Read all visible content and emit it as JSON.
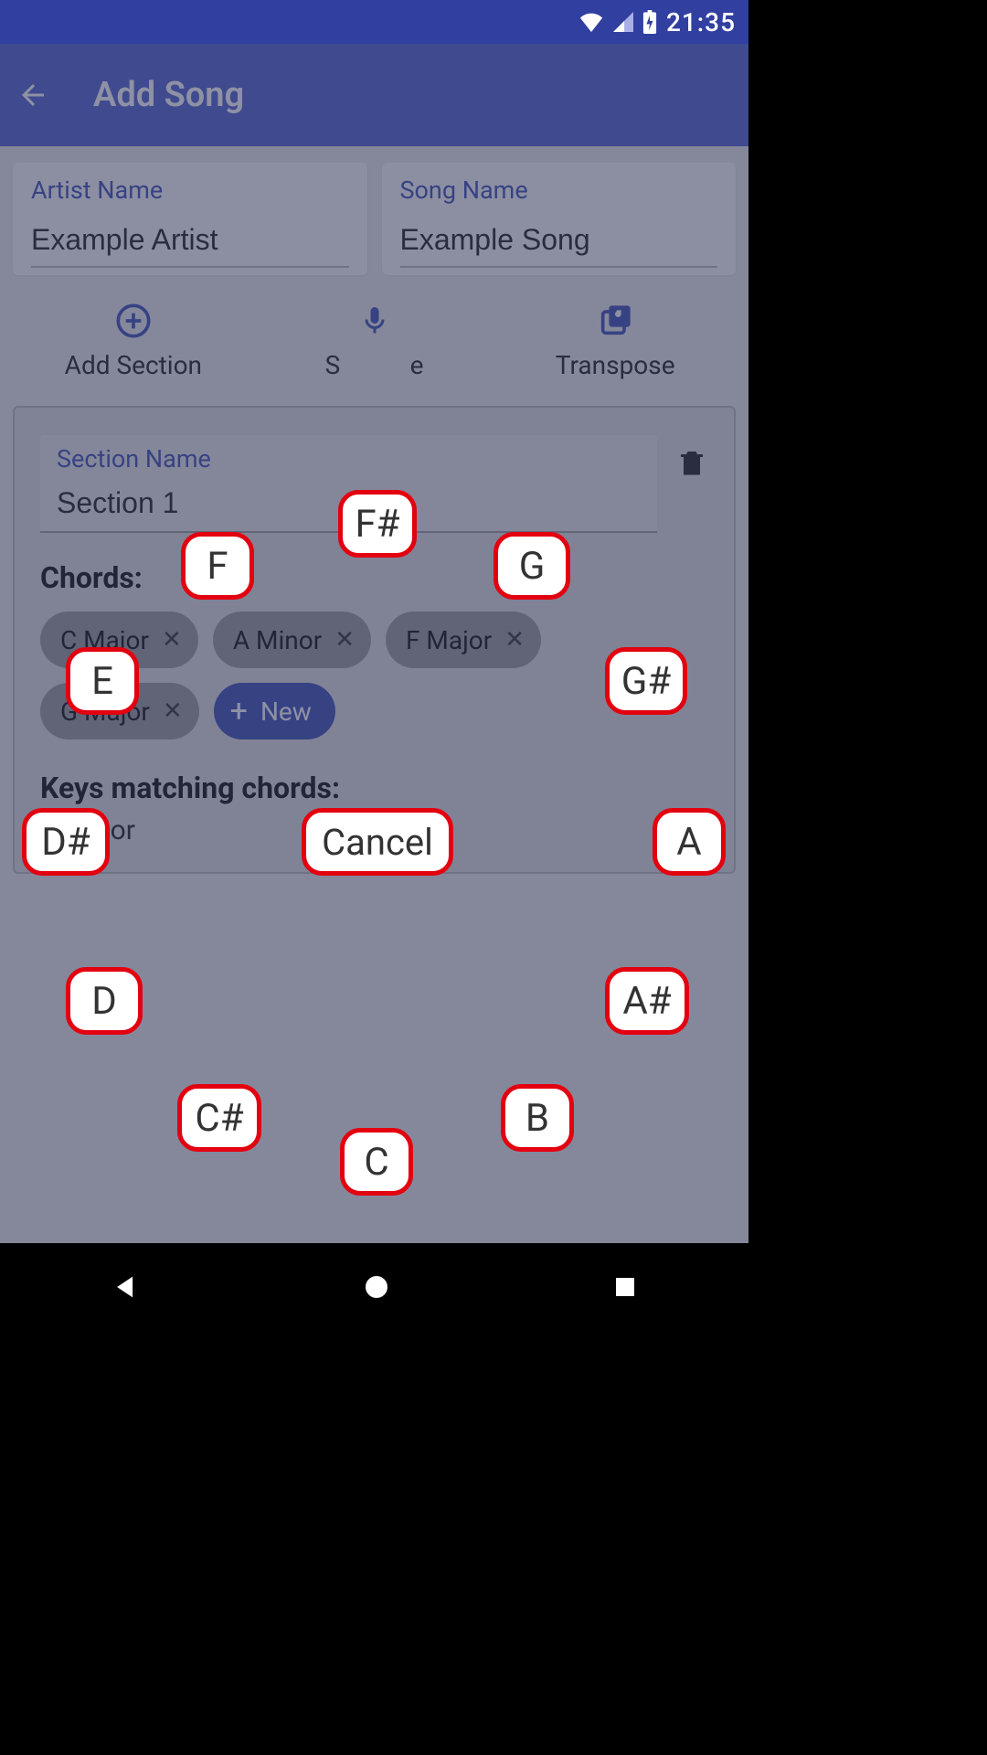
{
  "status": {
    "time": "21:35"
  },
  "appbar": {
    "title": "Add Song"
  },
  "fields": {
    "artist_label": "Artist Name",
    "artist_value": "Example Artist",
    "song_label": "Song Name",
    "song_value": "Example Song"
  },
  "actions": {
    "add_section_label": "Add Section",
    "middle_partial_left": "S",
    "middle_partial_right": "e",
    "transpose_label": "Transpose"
  },
  "section": {
    "name_label": "Section Name",
    "name_value": "Section 1",
    "chords_title": "Chords:",
    "chords": [
      "C Major",
      "A Minor",
      "F Major",
      "G Major"
    ],
    "new_label": "New",
    "keys_title": "Keys matching chords:",
    "keys_value": "C Major"
  },
  "picker": {
    "cancel": "Cancel",
    "notes": {
      "c": "C",
      "cs": "C#",
      "d": "D",
      "ds": "D#",
      "e": "E",
      "f": "F",
      "fs": "F#",
      "g": "G",
      "gs": "G#",
      "a": "A",
      "as": "A#",
      "b": "B"
    }
  },
  "colors": {
    "primary": "#5262ce",
    "primary_dark": "#313fa1",
    "accent": "#3f51b5",
    "danger": "#e3000f"
  }
}
